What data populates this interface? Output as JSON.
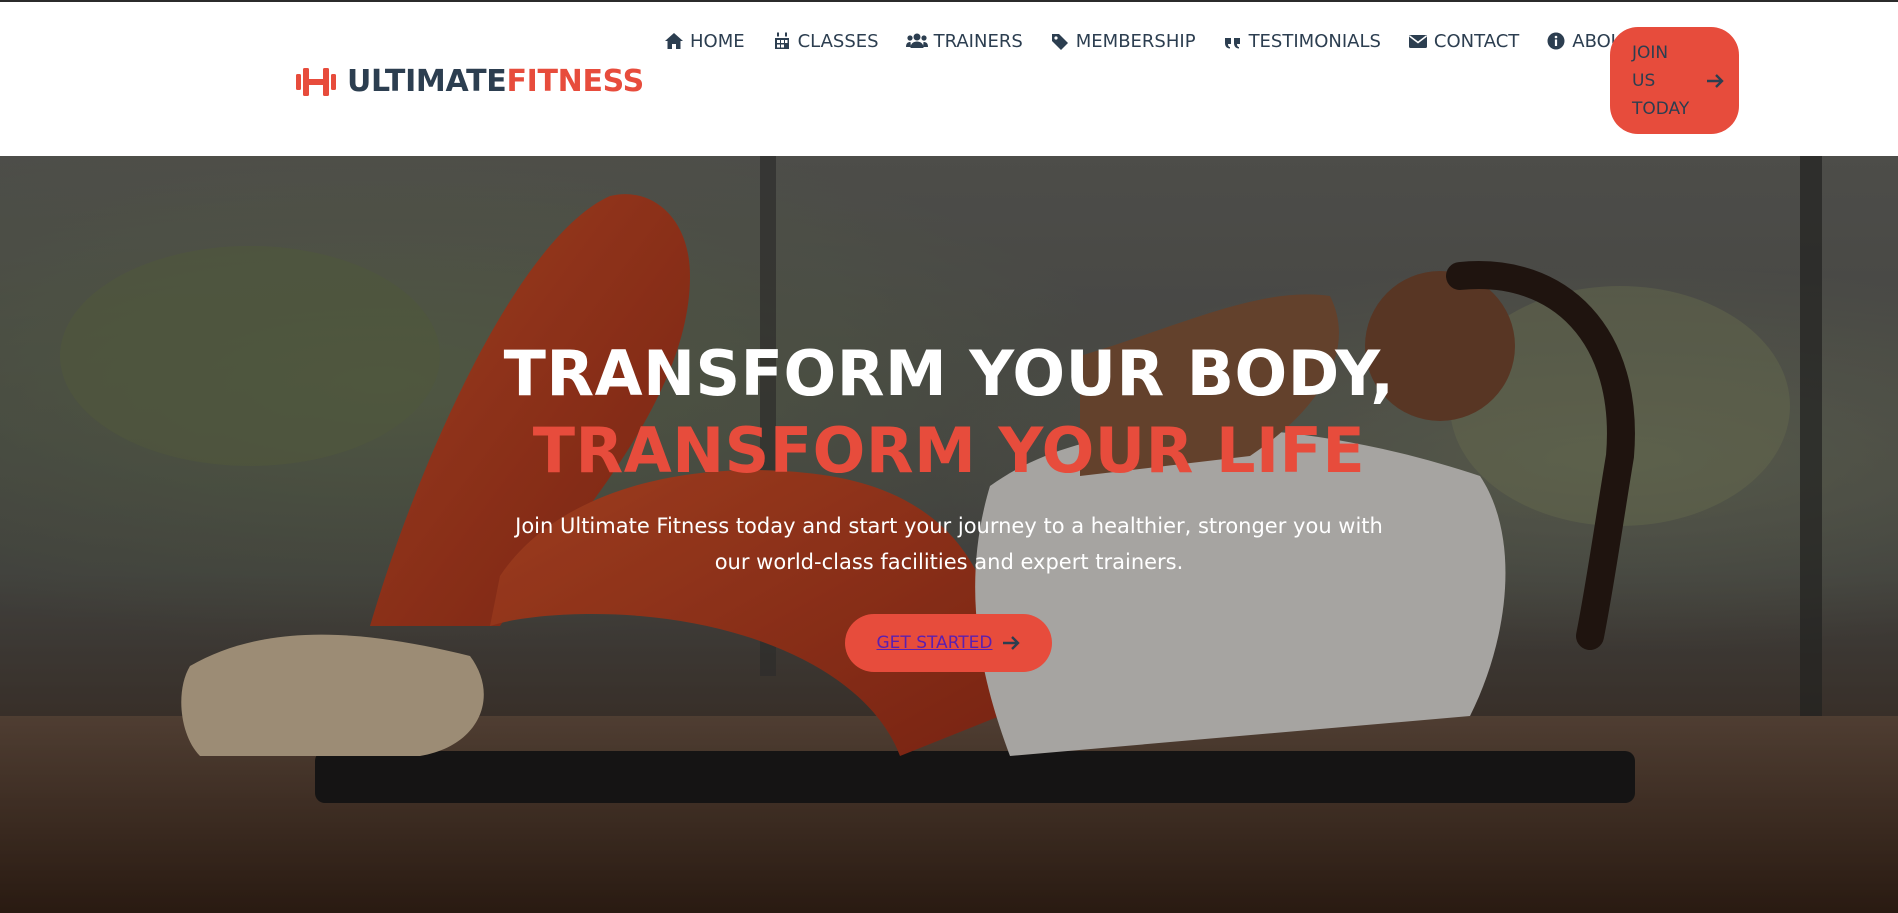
{
  "brand": {
    "name_part1": "ULTIMATE",
    "name_part2": "FITNESS",
    "icon": "dumbbell-icon"
  },
  "nav": {
    "items": [
      {
        "label": "HOME",
        "icon": "home-icon"
      },
      {
        "label": "CLASSES",
        "icon": "calendar-icon"
      },
      {
        "label": "TRAINERS",
        "icon": "users-icon"
      },
      {
        "label": "MEMBERSHIP",
        "icon": "tag-icon"
      },
      {
        "label": "TESTIMONIALS",
        "icon": "quote-icon"
      },
      {
        "label": "CONTACT",
        "icon": "envelope-icon"
      },
      {
        "label": "ABOUT",
        "icon": "info-circle-icon"
      }
    ],
    "join_label": "JOIN US TODAY"
  },
  "hero": {
    "headline_line1": "TRANSFORM YOUR BODY,",
    "headline_line2": "TRANSFORM YOUR LIFE",
    "subtext": "Join Ultimate Fitness today and start your journey to a healthier, stronger you with our world-class facilities and expert trainers.",
    "cta_label": "GET STARTED"
  },
  "colors": {
    "accent": "#e74c3c",
    "nav_text": "#2c3e50",
    "header_bg": "#ffffff",
    "hero_text": "#ffffff"
  }
}
